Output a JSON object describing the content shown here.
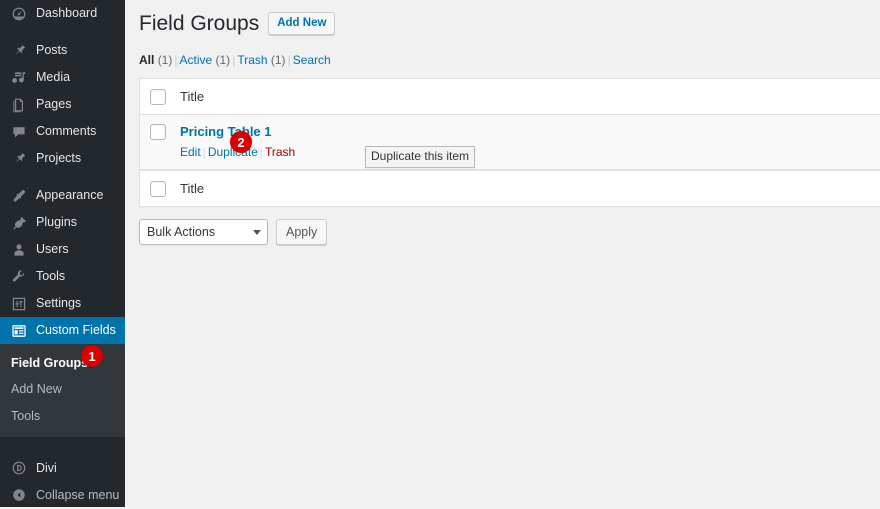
{
  "sidebar": {
    "items": [
      {
        "label": "Dashboard",
        "icon": "dashboard-icon",
        "name": "sidebar-item-dashboard",
        "gap_after": true
      },
      {
        "label": "Posts",
        "icon": "pin-icon",
        "name": "sidebar-item-posts"
      },
      {
        "label": "Media",
        "icon": "media-icon",
        "name": "sidebar-item-media"
      },
      {
        "label": "Pages",
        "icon": "pages-icon",
        "name": "sidebar-item-pages"
      },
      {
        "label": "Comments",
        "icon": "comments-icon",
        "name": "sidebar-item-comments"
      },
      {
        "label": "Projects",
        "icon": "pin-icon",
        "name": "sidebar-item-projects",
        "gap_after": true
      },
      {
        "label": "Appearance",
        "icon": "appearance-brush-icon",
        "name": "sidebar-item-appearance"
      },
      {
        "label": "Plugins",
        "icon": "plugin-icon",
        "name": "sidebar-item-plugins"
      },
      {
        "label": "Users",
        "icon": "users-icon",
        "name": "sidebar-item-users"
      },
      {
        "label": "Tools",
        "icon": "wrench-icon",
        "name": "sidebar-item-tools"
      },
      {
        "label": "Settings",
        "icon": "settings-sliders-icon",
        "name": "sidebar-item-settings"
      },
      {
        "label": "Custom Fields",
        "icon": "custom-fields-grid-icon",
        "name": "sidebar-item-custom-fields",
        "current": true
      }
    ],
    "submenu": [
      {
        "label": "Field Groups",
        "name": "submenu-item-field-groups",
        "current": true
      },
      {
        "label": "Add New",
        "name": "submenu-item-add-new",
        "current": false
      },
      {
        "label": "Tools",
        "name": "submenu-item-tools",
        "current": false
      }
    ],
    "bottom": [
      {
        "label": "Divi",
        "icon": "divi-icon",
        "name": "sidebar-item-divi"
      },
      {
        "label": "Collapse menu",
        "icon": "collapse-arrow-icon",
        "name": "collapse-menu-button"
      }
    ]
  },
  "header": {
    "title": "Field Groups",
    "add_new_label": "Add New"
  },
  "filters": [
    {
      "label": "All",
      "count": "(1)",
      "current": true,
      "name": "filter-link-all"
    },
    {
      "label": "Active",
      "count": "(1)",
      "current": false,
      "name": "filter-link-active"
    },
    {
      "label": "Trash",
      "count": "(1)",
      "current": false,
      "name": "filter-link-trash"
    },
    {
      "label": "Search",
      "count": "",
      "current": false,
      "name": "filter-link-search"
    }
  ],
  "table": {
    "column_title": "Title",
    "rows": [
      {
        "title": "Pricing Table 1",
        "actions": [
          {
            "label": "Edit",
            "name": "row-action-edit",
            "style": "normal"
          },
          {
            "label": "Duplicate",
            "name": "row-action-duplicate",
            "style": "normal"
          },
          {
            "label": "Trash",
            "name": "row-action-trash",
            "style": "trash"
          }
        ]
      }
    ]
  },
  "tooltip": {
    "text": "Duplicate this item"
  },
  "tablenav": {
    "bulk_actions_label": "Bulk Actions",
    "apply_label": "Apply"
  },
  "annotations": [
    {
      "number": "1",
      "name": "step-badge-1",
      "color": "#d80000"
    },
    {
      "number": "2",
      "name": "step-badge-2",
      "color": "#d80000"
    }
  ]
}
